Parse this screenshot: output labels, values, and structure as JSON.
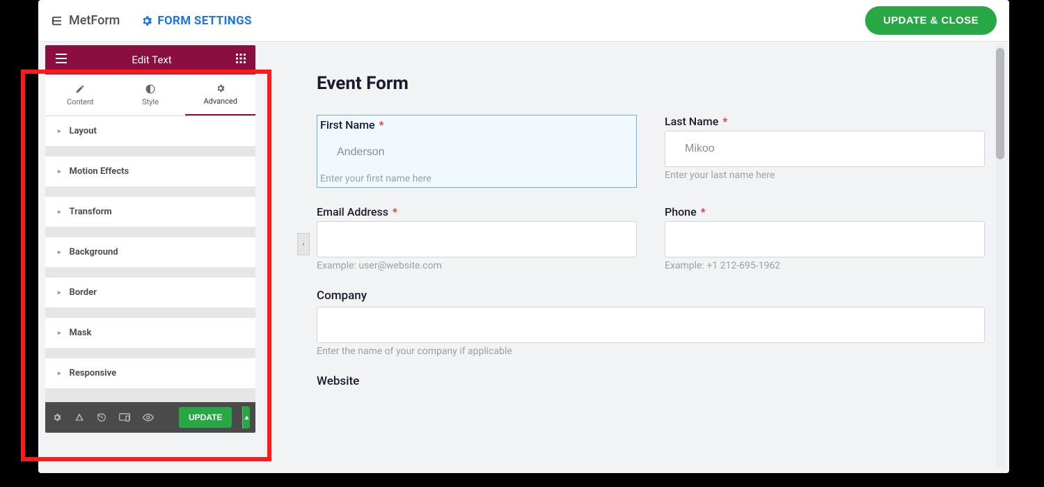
{
  "topbar": {
    "brand": "MetForm",
    "settings": "FORM SETTINGS",
    "update_close": "UPDATE & CLOSE"
  },
  "panel": {
    "title": "Edit Text",
    "tabs": {
      "content": "Content",
      "style": "Style",
      "advanced": "Advanced"
    },
    "sections": [
      "Layout",
      "Motion Effects",
      "Transform",
      "Background",
      "Border",
      "Mask",
      "Responsive"
    ],
    "update": "UPDATE"
  },
  "canvas": {
    "heading": "Event Form",
    "fields": {
      "first_name": {
        "label": "First Name",
        "placeholder": "Anderson",
        "help": "Enter your first name here",
        "required": true
      },
      "last_name": {
        "label": "Last Name",
        "placeholder": "Mikoo",
        "help": "Enter your last name here",
        "required": true
      },
      "email": {
        "label": "Email Address",
        "help": "Example: user@website.com",
        "required": true
      },
      "phone": {
        "label": "Phone",
        "help": "Example: +1 212-695-1962",
        "required": true
      },
      "company": {
        "label": "Company",
        "help": "Enter the name of your company if applicable"
      },
      "website": {
        "label": "Website"
      }
    }
  }
}
